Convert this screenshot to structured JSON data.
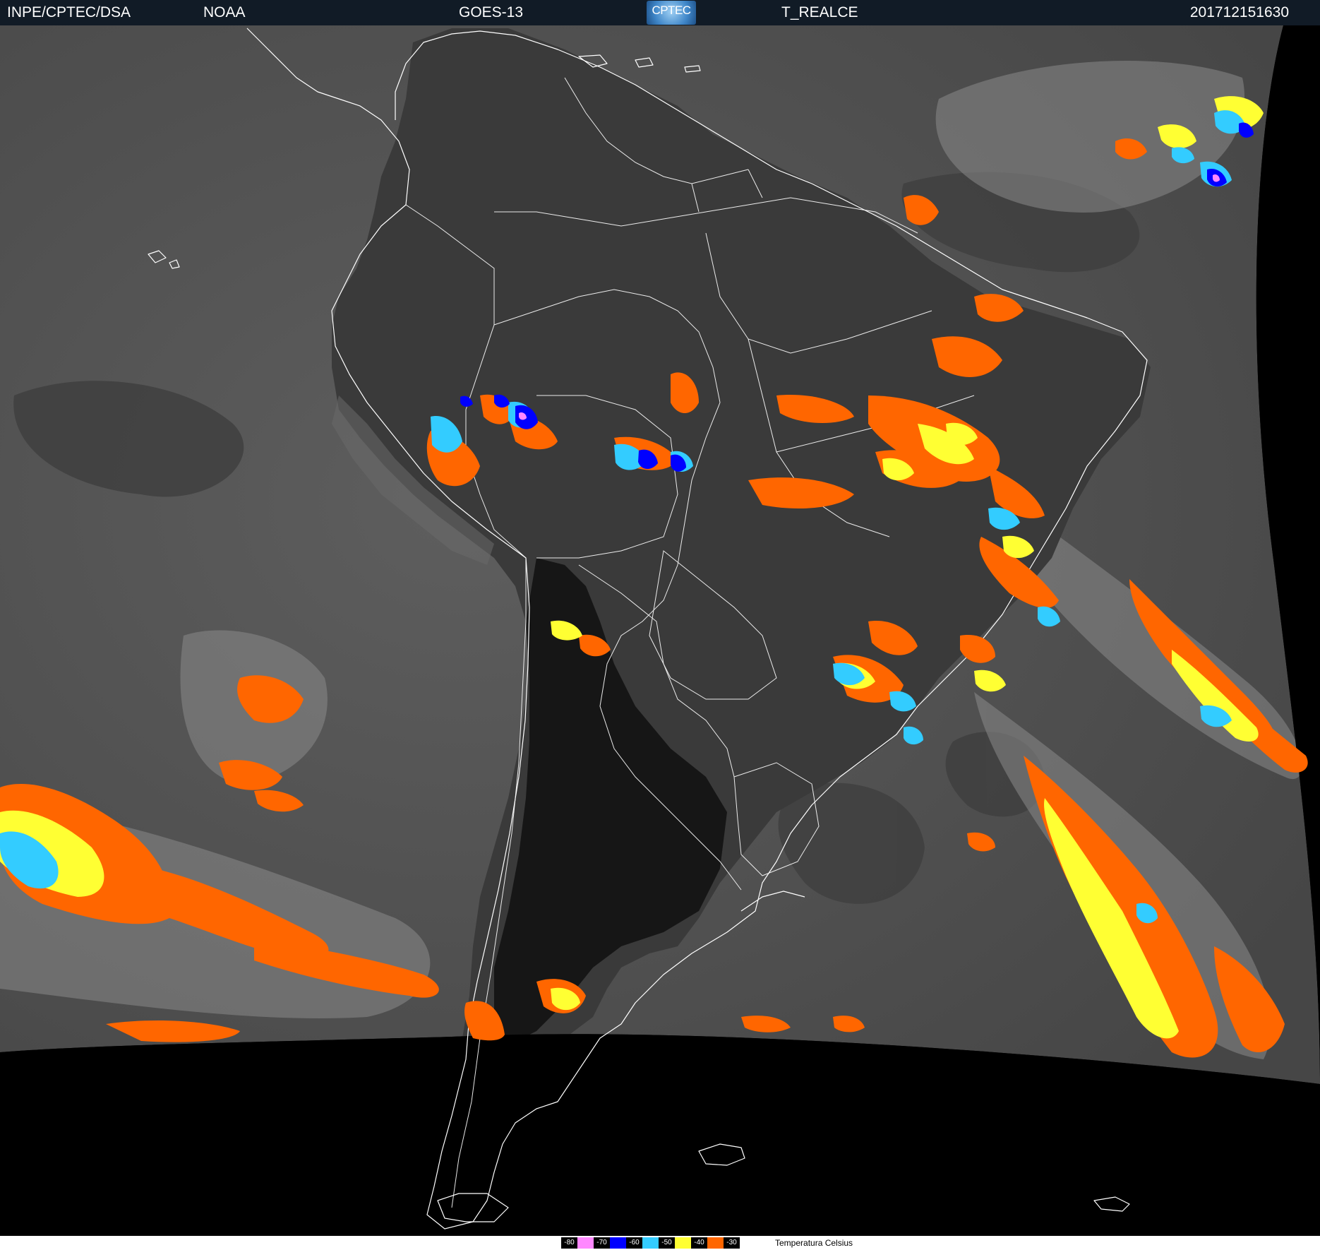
{
  "header": {
    "source": "INPE/CPTEC/DSA",
    "agency": "NOAA",
    "satellite": "GOES-13",
    "logo_text": "CPTEC",
    "product": "T_REALCE",
    "timestamp": "201712151630"
  },
  "legend": {
    "unit_label": "Temperatura  Celsius",
    "classes": [
      {
        "label": "-80",
        "color": "#ff88ff"
      },
      {
        "label": "-70",
        "color": "#0000ff"
      },
      {
        "label": "-60",
        "color": "#33ccff"
      },
      {
        "label": "-50",
        "color": "#ffff33"
      },
      {
        "label": "-40",
        "color": "#ff6600"
      },
      {
        "label": "-30",
        "color": "#ffffff"
      }
    ]
  },
  "map": {
    "background_color": "#505050",
    "space_color": "#000000",
    "coastline_color": "#ffffff"
  }
}
